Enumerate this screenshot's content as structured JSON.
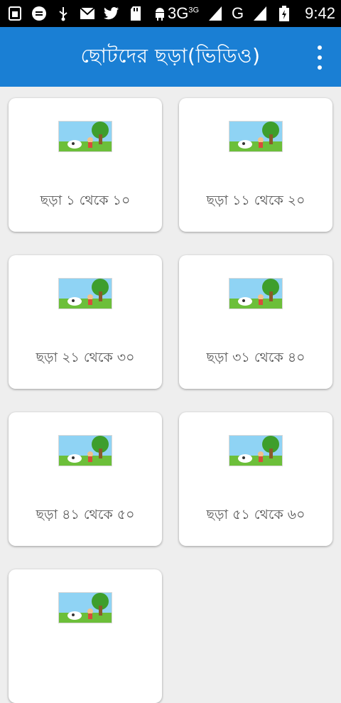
{
  "status_bar": {
    "network_label": "3G",
    "network_sup": "3G",
    "network_g": "G",
    "time": "9:42"
  },
  "app_bar": {
    "title": "ছোটদের ছড়া(ভিডিও)"
  },
  "cards": [
    {
      "label": "ছড়া ১ থেকে ১০"
    },
    {
      "label": "ছড়া ১১ থেকে ২০"
    },
    {
      "label": "ছড়া ২১ থেকে ৩০"
    },
    {
      "label": "ছড়া ৩১ থেকে ৪০"
    },
    {
      "label": "ছড়া ৪১ থেকে ৫০"
    },
    {
      "label": "ছড়া ৫১ থেকে ৬০"
    },
    {
      "label": ""
    }
  ],
  "colors": {
    "app_bar": "#1a7fd4",
    "background": "#eeeeee",
    "card": "#ffffff"
  }
}
